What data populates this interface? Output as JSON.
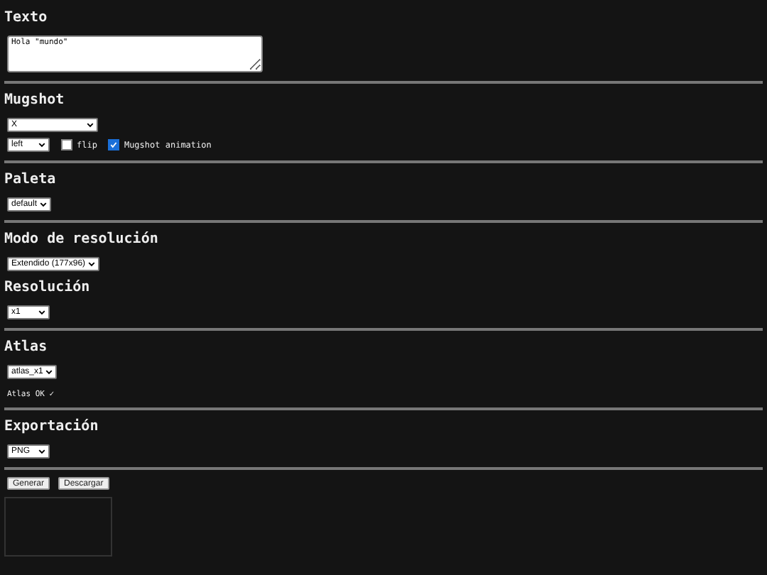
{
  "sections": [
    {
      "title": "Texto",
      "divider": true,
      "rows": [
        [
          {
            "kind": "textarea",
            "value": "Hola \"mundo\""
          }
        ]
      ]
    },
    {
      "title": "Mugshot",
      "divider": true,
      "rows": [
        [
          {
            "kind": "wide-select",
            "value": "X"
          }
        ],
        [
          {
            "kind": "select",
            "value": "left"
          },
          {
            "kind": "checkbox",
            "label": "flip",
            "checked": false
          },
          {
            "kind": "checkbox",
            "label": "Mugshot animation",
            "checked": true
          }
        ]
      ]
    },
    {
      "title": "Paleta",
      "divider": true,
      "rows": [
        [
          {
            "kind": "select",
            "value": "default"
          }
        ]
      ]
    },
    {
      "title": "Modo de resolución",
      "divider": false,
      "rows": [
        [
          {
            "kind": "select",
            "value": "Extendido (177x96)"
          }
        ]
      ]
    },
    {
      "title": "Resolución",
      "divider": true,
      "rows": [
        [
          {
            "kind": "select",
            "value": "x1"
          }
        ]
      ]
    },
    {
      "title": "Atlas",
      "divider": true,
      "rows": [
        [
          {
            "kind": "select",
            "value": "atlas_x1"
          }
        ],
        [
          {
            "kind": "status",
            "text": "Atlas OK ✓"
          }
        ]
      ]
    },
    {
      "title": "Exportación",
      "divider": true,
      "rows": [
        [
          {
            "kind": "select",
            "value": "PNG"
          }
        ]
      ]
    }
  ],
  "buttons": [
    "Generar",
    "Descargar"
  ]
}
